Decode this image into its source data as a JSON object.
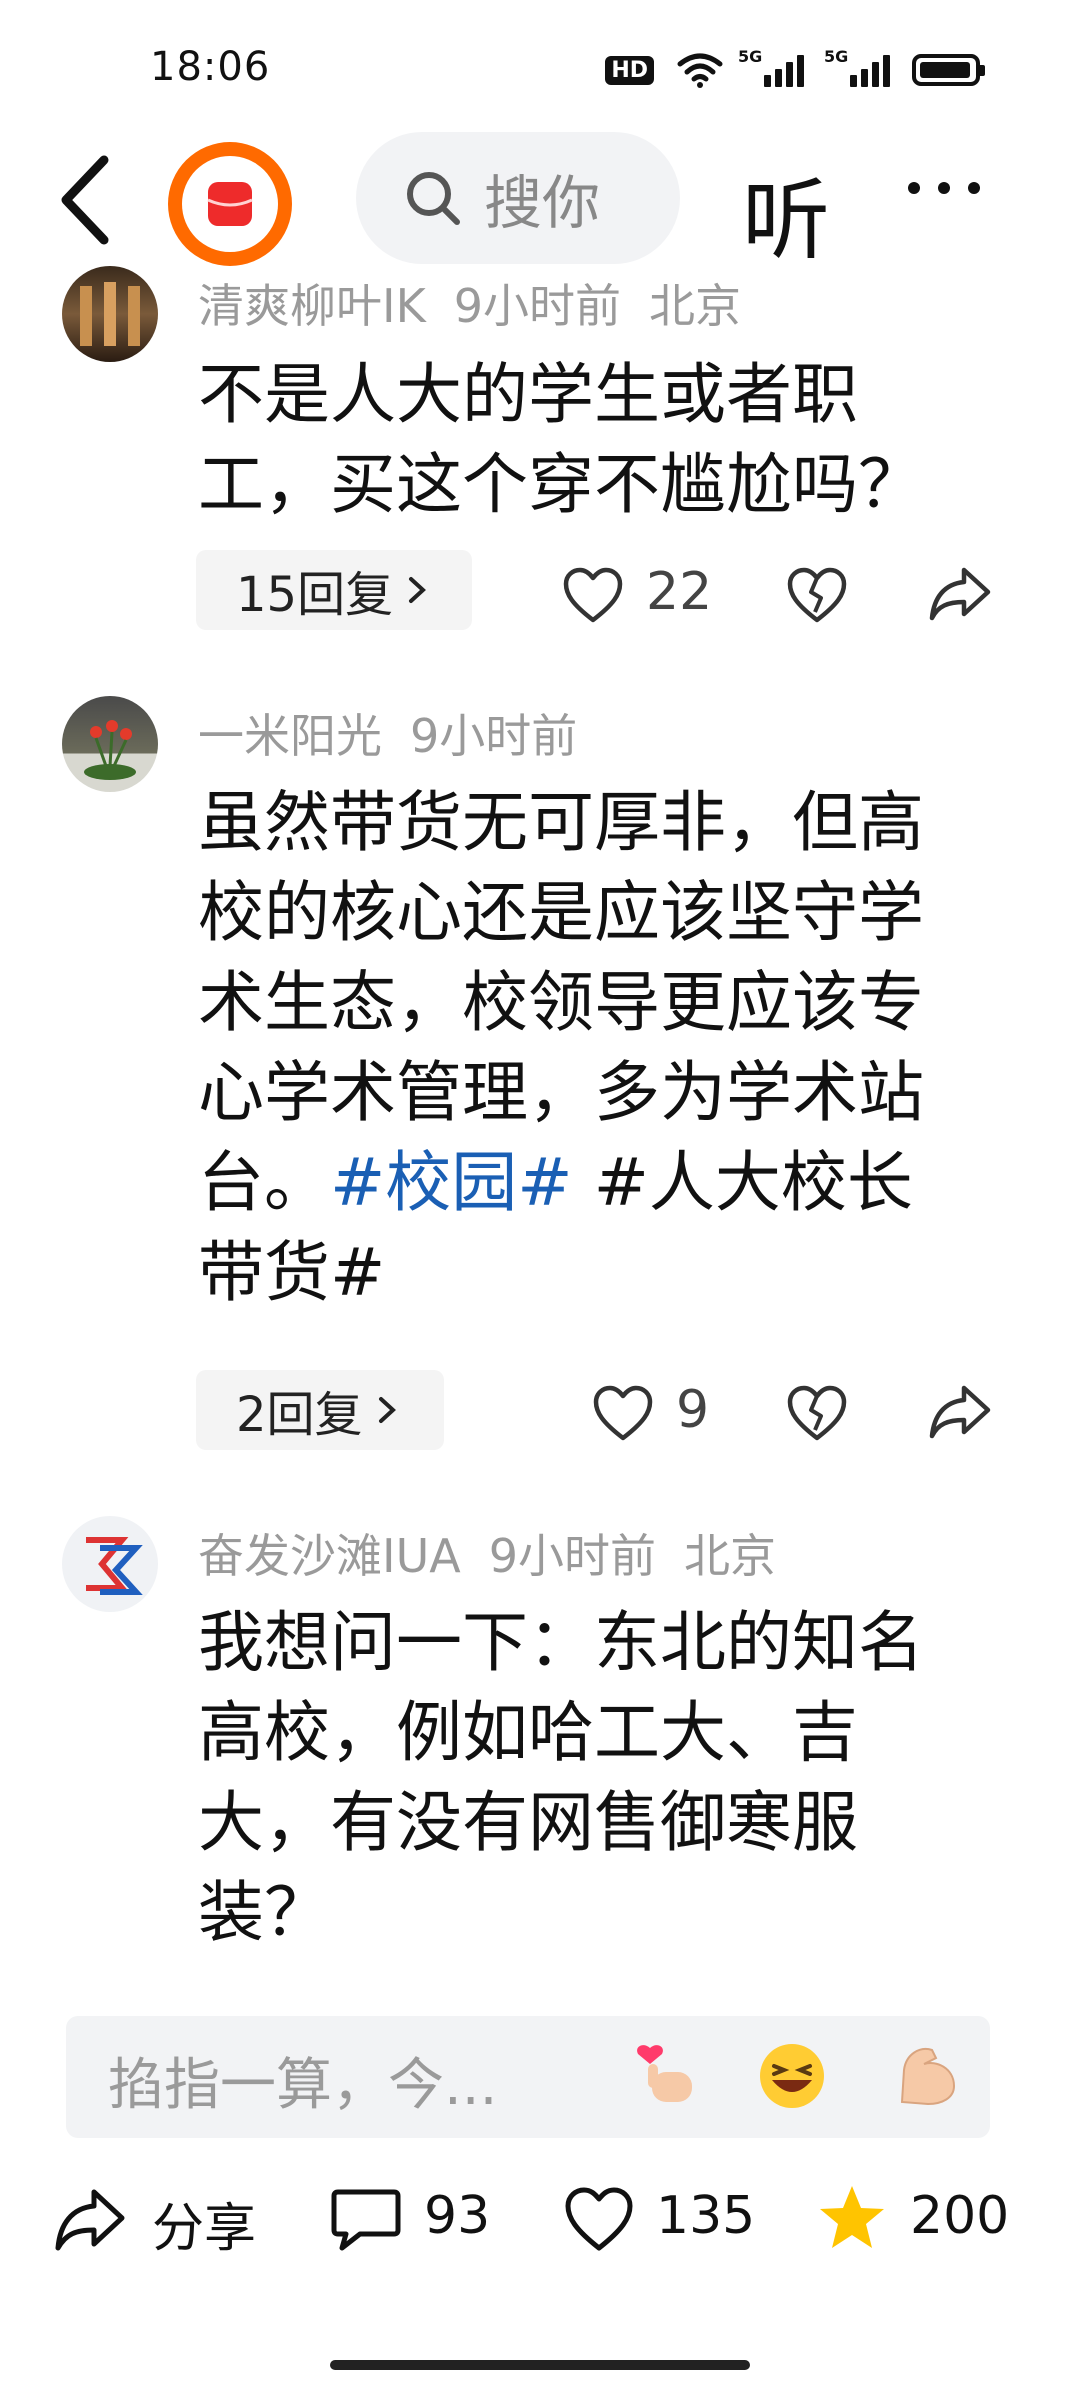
{
  "status_bar": {
    "time": "18:06",
    "hd_label": "HD",
    "net1": "5G",
    "net2": "5G"
  },
  "top_bar": {
    "search_placeholder": "搜你",
    "listen_label": "听"
  },
  "comments": [
    {
      "author": "清爽柳叶IK",
      "time": "9小时前",
      "location": "北京",
      "text": "不是人大的学生或者职工，买这个穿不尴尬吗？",
      "replies": "15回复",
      "likes": "22"
    },
    {
      "author": "一米阳光",
      "time": "9小时前",
      "text_plain": "虽然带货无可厚非，但高校的核心还是应该坚守学术生态，校领导更应该专心学术管理，多为学术站台。",
      "hashtag": "#校园#",
      "text_tail": " #人大校长带货#",
      "replies": "2回复",
      "likes": "9"
    },
    {
      "author": "奋发沙滩IUA",
      "time": "9小时前",
      "location": "北京",
      "text": "我想问一下：东北的知名高校，例如哈工大、吉大，有没有网售御寒服装？"
    }
  ],
  "input_bar": {
    "placeholder": "掐指一算，今...",
    "emoji_icons": [
      "heart-hand-emoji-icon",
      "laughing-emoji-icon",
      "flexed-biceps-emoji-icon"
    ]
  },
  "bottom_bar": {
    "share_label": "分享",
    "comment_count": "93",
    "like_count": "135",
    "favorite_count": "200"
  },
  "colors": {
    "hashtag": "#1a5fb4",
    "star": "#ffc400",
    "app_accent": "#ff6a00"
  }
}
